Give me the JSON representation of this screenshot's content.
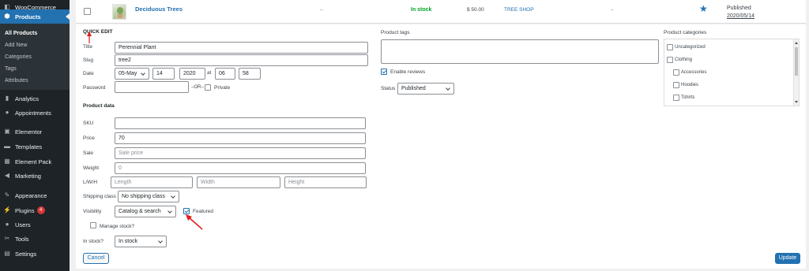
{
  "sidebar": {
    "woocommerce": "WooCommerce",
    "products": "Products",
    "sub": [
      "All Products",
      "Add New",
      "Categories",
      "Tags",
      "Attributes"
    ],
    "analytics": "Analytics",
    "appointments": "Appointments",
    "elementor": "Elementor",
    "templates": "Templates",
    "element_pack": "Element Pack",
    "marketing": "Marketing",
    "appearance": "Appearance",
    "plugins": "Plugins",
    "plugins_badge": "4",
    "users": "Users",
    "tools": "Tools",
    "settings": "Settings"
  },
  "product_row": {
    "name": "Deciduous Trees",
    "sku": "–",
    "stock": "In stock",
    "price": "$ 50.00",
    "category": "TREE SHOP",
    "tags": "–",
    "status": "Published",
    "date": "2020/05/14"
  },
  "quick_edit": {
    "heading": "QUICK EDIT",
    "title_label": "Title",
    "title_value": "Perennial Plant",
    "slug_label": "Slug",
    "slug_value": "tree2",
    "date_label": "Date",
    "month": "05-May",
    "day": "14",
    "year": "2020",
    "at": "at",
    "hour": "06",
    "minute": "58",
    "password_label": "Password",
    "or_text": "–OR–",
    "private_label": "Private",
    "product_data": "Product data",
    "sku_label": "SKU",
    "sku_value": "",
    "price_label": "Price",
    "price_value": "70",
    "sale_label": "Sale",
    "sale_placeholder": "Sale price",
    "weight_label": "Weight",
    "weight_placeholder": "0",
    "lwh_label": "L/W/H",
    "length_ph": "Length",
    "width_ph": "Width",
    "height_ph": "Height",
    "shipping_label": "Shipping class",
    "shipping_value": "No shipping class",
    "visibility_label": "Visibility",
    "visibility_value": "Catalog & search",
    "featured_label": "Featured",
    "manage_stock_label": "Manage stock?",
    "in_stock_label": "In stock?",
    "in_stock_value": "In stock",
    "cancel": "Cancel",
    "update": "Update",
    "tags_heading": "Product tags",
    "enable_reviews": "Enable reviews",
    "status_label": "Status",
    "status_value": "Published",
    "categories_heading": "Product categories",
    "categories": [
      "Uncategorized",
      "Clothing",
      "Accessories",
      "Hoodies",
      "Tshirts"
    ]
  },
  "colors": {
    "accent": "#2271b1",
    "stock_green": "#00a32a",
    "annotation_red": "#e01b1b",
    "sidebar_bg": "#1d2327"
  }
}
